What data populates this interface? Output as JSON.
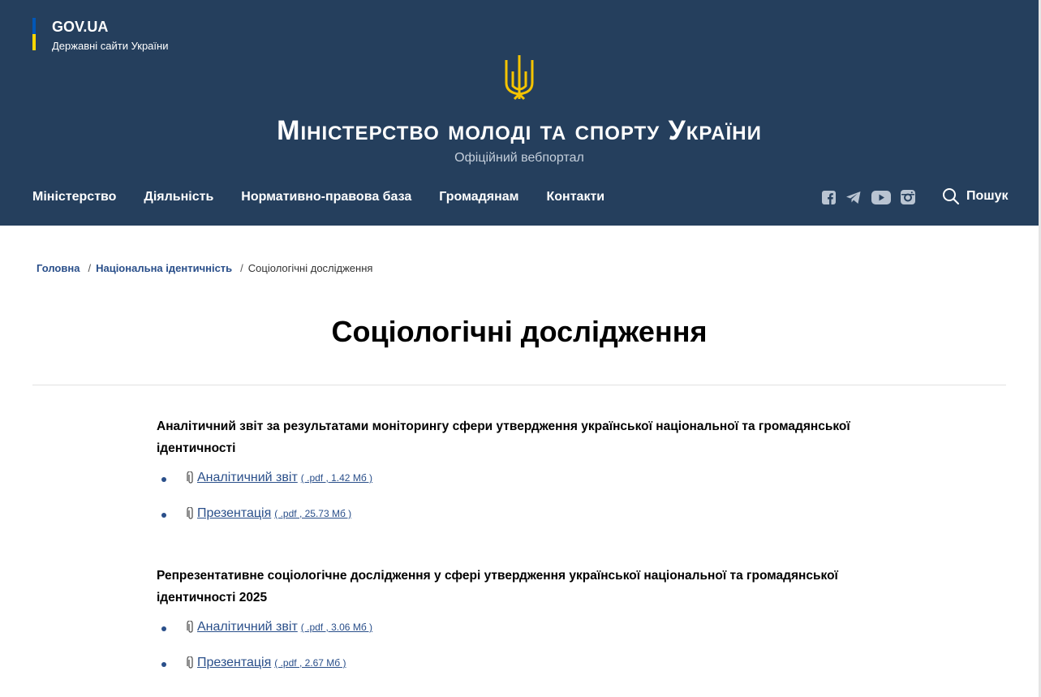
{
  "govua": {
    "title": "GOV.UA",
    "subtitle": "Державні сайти України"
  },
  "site": {
    "title": "Міністерство молоді та спорту України",
    "subtitle": "Офіційний вебпортал"
  },
  "nav": [
    {
      "label": "Міністерство"
    },
    {
      "label": "Діяльність"
    },
    {
      "label": "Нормативно-правова база"
    },
    {
      "label": "Громадянам"
    },
    {
      "label": "Контакти"
    }
  ],
  "social": [
    "facebook-icon",
    "telegram-icon",
    "youtube-icon",
    "instagram-icon"
  ],
  "search": {
    "label": "Пошук"
  },
  "breadcrumb": [
    {
      "label": "Головна"
    },
    {
      "label": "Національна ідентичність"
    },
    {
      "label": "Соціологічні дослідження"
    }
  ],
  "page": {
    "title": "Соціологічні дослідження"
  },
  "sections": [
    {
      "title": "Аналітичний звіт за результатами моніторингу сфери утвердження української національної та громадянської ідентичності",
      "files": [
        {
          "label": "Аналітичний звіт",
          "meta": "( .pdf , 1.42 Мб )"
        },
        {
          "label": "Презентація",
          "meta": "( .pdf , 25.73 Мб )"
        }
      ]
    },
    {
      "title": "Репрезентативне соціологічне дослідження у сфері утвердження української національної та громадянської ідентичності 2025",
      "files": [
        {
          "label": "Аналітичний звіт",
          "meta": "( .pdf , 3.06 Мб )"
        },
        {
          "label": "Презентація",
          "meta": "( .pdf , 2.67 Мб )"
        }
      ]
    }
  ],
  "colors": {
    "header_bg": "#253f5d",
    "link": "#2a4f8a",
    "flag_blue": "#0057b8",
    "flag_yellow": "#ffd700",
    "trident": "#f5c400"
  }
}
